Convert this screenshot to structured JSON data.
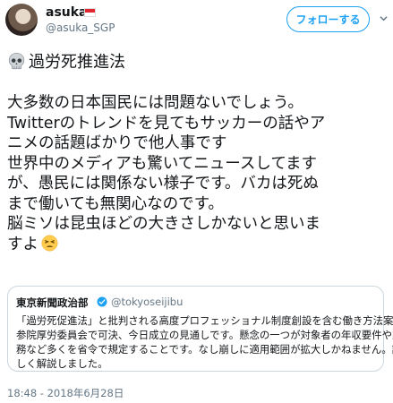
{
  "user": {
    "name": "asuka",
    "handle": "@asuka_SGP"
  },
  "actions": {
    "follow_label": "フォローする"
  },
  "tweet": {
    "title": "過労死推進法",
    "lines": [
      "大多数の日本国民には問題ないでしょう。",
      "Twitterのトレンドを見てもサッカーの話やア",
      "ニメの話題ばかりで他人事です",
      "世界中のメディアも驚いてニュースしてます",
      "が、愚民には関係ない様子です。バカは死ぬ",
      "まで働いても無関心なのです。",
      "脳ミソは昆虫ほどの大きさしかないと思いま",
      "すよ"
    ],
    "timestamp": "18:48 - 2018年6月28日"
  },
  "quoted": {
    "name": "東京新聞政治部",
    "handle": "@tokyoseijibu",
    "lines": [
      "「過労死促進法」と批判される高度プロフェッショナル制度創設を含む働き方法案が",
      "参院厚労委員会で可決、今日成立の見通しです。懸念の一つが対象者の年収要件や業",
      "務など多くを省令で規定することです。なし崩しに適用範囲が拡大しかねません。詳",
      "しく解説しました。"
    ]
  },
  "icons": {
    "flag": "singapore-flag-icon",
    "skull": "skull-icon",
    "tired_face": "tired-face-icon",
    "verified": "verified-badge-icon",
    "caret": "chevron-down-icon"
  },
  "colors": {
    "accent": "#1da1f2",
    "text": "#14171a",
    "muted": "#657786",
    "border": "#ccd6dd"
  }
}
